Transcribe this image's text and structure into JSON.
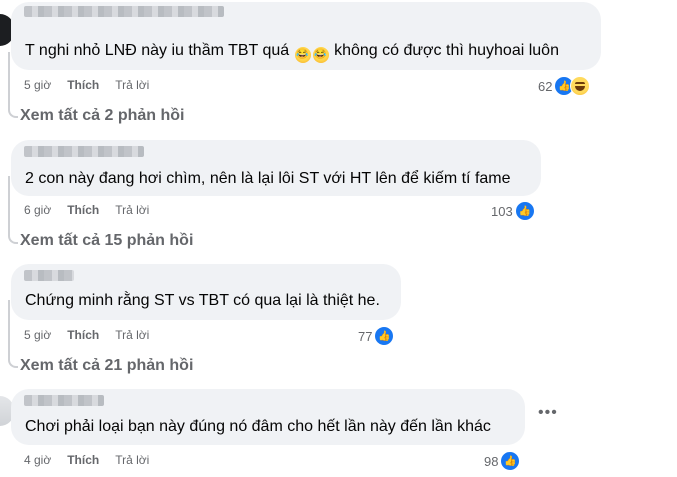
{
  "comments": [
    {
      "text_before": "T nghi nhỏ LNĐ này iu thầm TBT quá",
      "text_after": "không có được thì huyhoai luôn",
      "inline_emojis": [
        "rolling-laugh-emoji",
        "rolling-laugh-emoji"
      ],
      "time": "5 giờ",
      "like_label": "Thích",
      "reply_label": "Trả lời",
      "reaction_count": "62",
      "reactions": [
        "like-icon",
        "haha-icon"
      ]
    },
    {
      "text": "2 con này đang hơi chìm, nên là lại lôi ST với HT lên để kiếm tí fame",
      "time": "6 giờ",
      "like_label": "Thích",
      "reply_label": "Trả lời",
      "reaction_count": "103",
      "reactions": [
        "like-icon"
      ]
    },
    {
      "text": "Chứng minh rằng ST vs TBT có qua lại là thiệt he.",
      "time": "5 giờ",
      "like_label": "Thích",
      "reply_label": "Trả lời",
      "reaction_count": "77",
      "reactions": [
        "like-icon"
      ]
    },
    {
      "text": "Chơi phải loại bạn này đúng nó đâm cho hết lần này đến lần khác",
      "time": "4 giờ",
      "like_label": "Thích",
      "reply_label": "Trả lời",
      "reaction_count": "98",
      "reactions": [
        "like-icon"
      ]
    }
  ],
  "view_replies": [
    "Xem tất cả 2 phản hồi",
    "Xem tất cả 15 phản hồi",
    "Xem tất cả 21 phản hồi"
  ],
  "colors": {
    "bubble": "#f0f2f5",
    "like_blue": "#1877f2",
    "secondary_text": "#65676b"
  }
}
